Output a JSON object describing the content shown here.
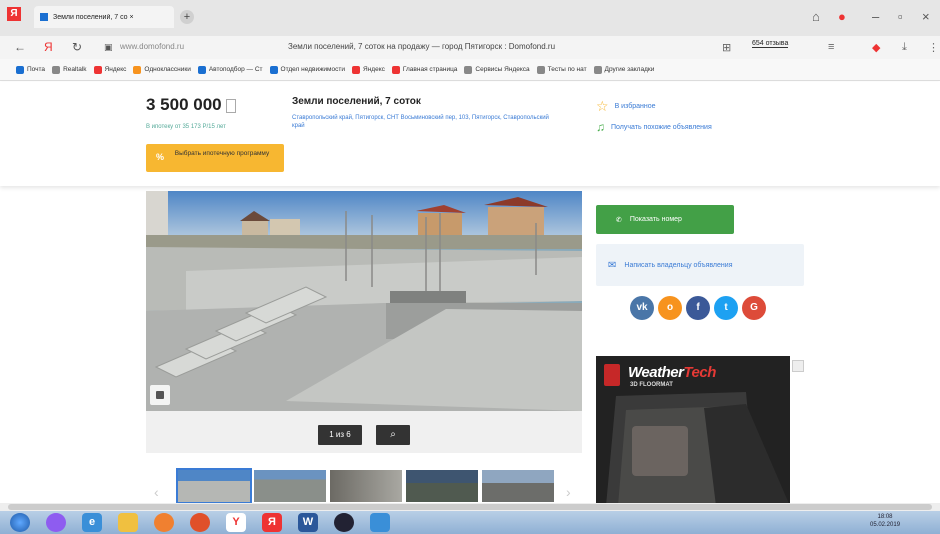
{
  "browser": {
    "tab_title": "Земли поселений, 7 со ×",
    "url": "www.domofond.ru",
    "page_title": "Земли поселений, 7 соток на продажу — город Пятигорск : Domofond.ru",
    "reviews_label": "654 отзыва",
    "bookmarks": [
      {
        "label": "Почта",
        "color": "#1a6fd1"
      },
      {
        "label": "Realtalk",
        "color": "#888"
      },
      {
        "label": "Яндекс",
        "color": "#e33"
      },
      {
        "label": "Одноклассники",
        "color": "#f7931e"
      },
      {
        "label": "Автоподбор — Ст",
        "color": "#1a6fd1"
      },
      {
        "label": "Отдел недвижимости",
        "color": "#1a6fd1"
      },
      {
        "label": "Яндекс",
        "color": "#e33"
      },
      {
        "label": "Главная страница",
        "color": "#e33"
      },
      {
        "label": "Сервисы Яндекса",
        "color": "#888"
      },
      {
        "label": "Тесты по нат",
        "color": "#888"
      },
      {
        "label": "Другие закладки",
        "color": "#888"
      }
    ]
  },
  "listing": {
    "price": "3 500 000",
    "mortgage_note": "В ипотеку от 35 173 Р/15 лет",
    "mortgage_button": "Выбрать ипотечную программу",
    "title": "Земли поселений, 7 соток",
    "address": "Ставропольский край, Пятигорск, СНТ Восьминовский пер, 103, Пятигорск, Ставропольский край",
    "favorite_label": "В избранное",
    "new_listing_label": "Получать похожие объявления",
    "phone_button": "Показать номер",
    "message_button": "Написать владельцу объявления",
    "photo_counter": "1 из 6"
  },
  "socials": [
    {
      "name": "vk",
      "label": "vk",
      "color": "#4a76a8"
    },
    {
      "name": "ok",
      "label": "о",
      "color": "#f7931e"
    },
    {
      "name": "facebook",
      "label": "f",
      "color": "#3b5998"
    },
    {
      "name": "twitter",
      "label": "t",
      "color": "#1da1f2"
    },
    {
      "name": "google",
      "label": "G",
      "color": "#dd4b39"
    }
  ],
  "ad": {
    "brand_a": "Weather",
    "brand_b": "Tech",
    "sub": "3D FLOORMAT"
  },
  "tray": {
    "time": "18:08",
    "date": "05.02.2019"
  }
}
